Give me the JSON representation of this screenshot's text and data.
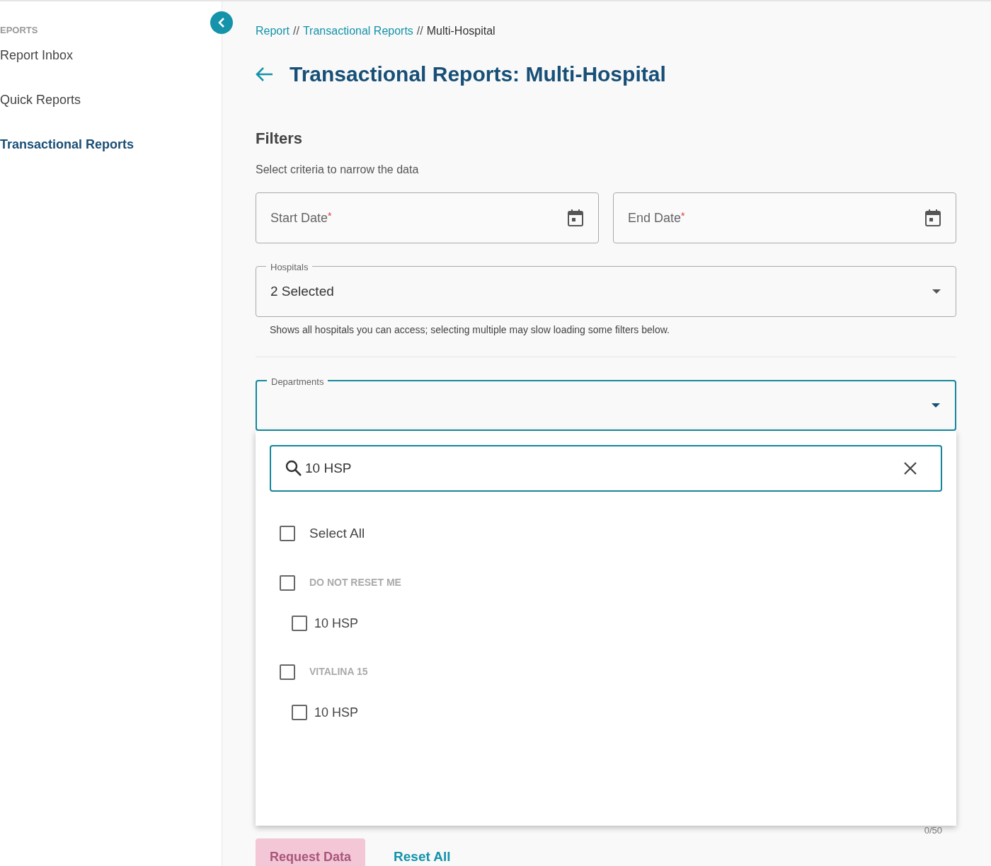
{
  "sidebar": {
    "section": "EPORTS",
    "items": [
      {
        "label": "Report Inbox",
        "selected": false
      },
      {
        "label": "Quick Reports",
        "selected": false
      },
      {
        "label": "Transactional Reports",
        "selected": true
      }
    ]
  },
  "breadcrumb": [
    {
      "label": "Report",
      "link": true
    },
    {
      "separator": "//",
      "label": "Transactional Reports",
      "link": true
    },
    {
      "separator": "//",
      "label": "Multi-Hospital",
      "link": false
    }
  ],
  "title": "Transactional Reports: Multi-Hospital",
  "filters": {
    "heading": "Filters",
    "subtitle": "Select criteria to narrow the data",
    "start_date": {
      "placeholder": "Start Date",
      "required_mark": "*"
    },
    "end_date": {
      "placeholder": "End Date",
      "required_mark": "*"
    },
    "hospitals": {
      "label": "Hospitals",
      "value": "2 Selected",
      "helper": "Shows all hospitals you can access; selecting multiple may slow loading some filters below."
    },
    "departments": {
      "label": "Departments",
      "expanded": true,
      "search": {
        "value": "10 HSP"
      },
      "select_all": {
        "label": "Select All",
        "checked": false
      },
      "options": [
        {
          "label": "DO NOT RESET ME",
          "checked": false,
          "children": [
            {
              "label": "10 HSP",
              "checked": false
            }
          ]
        },
        {
          "label": "VITALINA 15",
          "checked": false,
          "children": [
            {
              "label": "10 HSP",
              "checked": false
            }
          ]
        }
      ]
    },
    "counter": "0/50"
  },
  "buttons": {
    "request": {
      "label": "Request Data",
      "disabled": true
    },
    "reset": {
      "label": "Reset All"
    }
  }
}
